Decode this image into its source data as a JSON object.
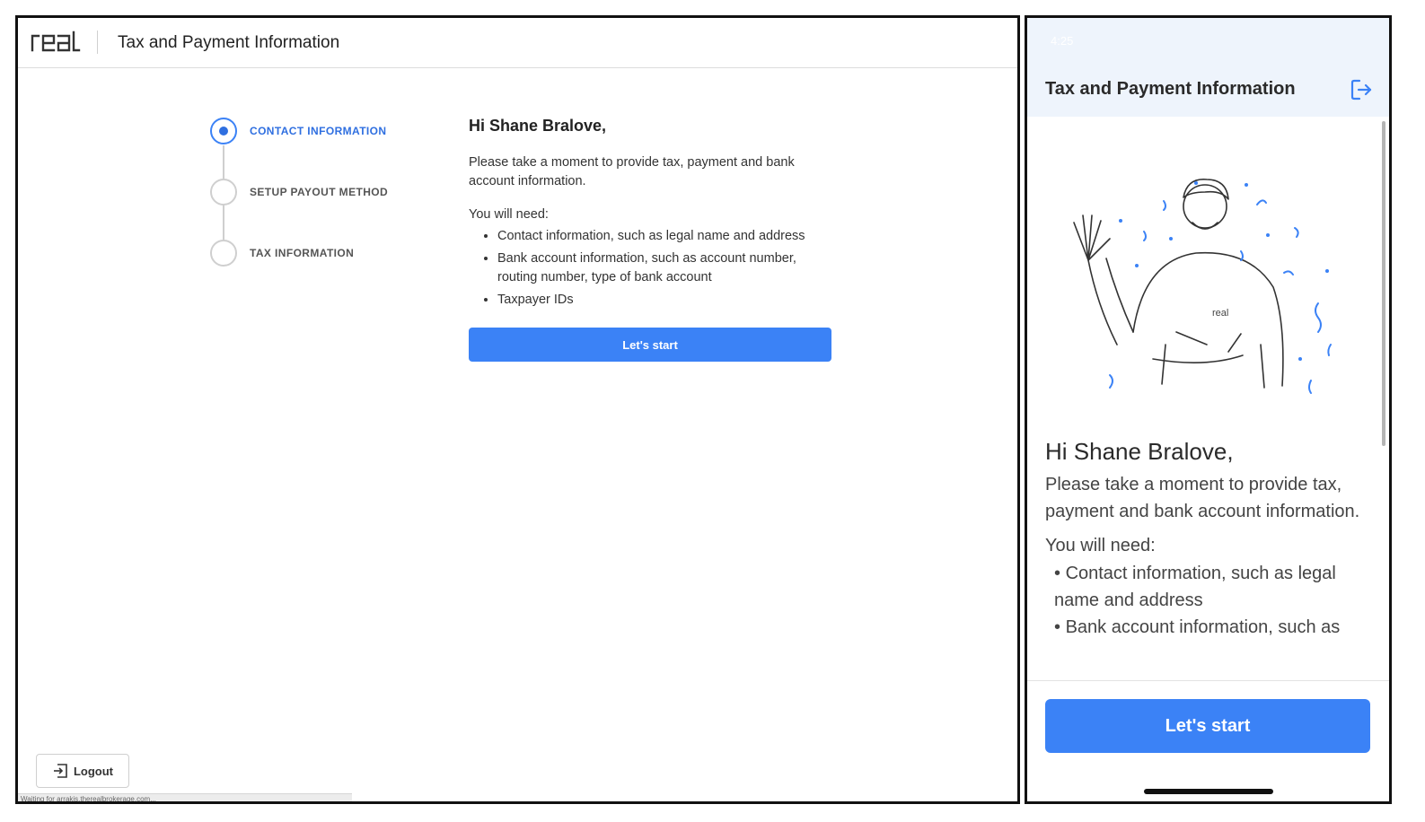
{
  "desktop": {
    "brand": "real",
    "header_title": "Tax and Payment Information",
    "steps": [
      {
        "label": "CONTACT INFORMATION"
      },
      {
        "label": "SETUP PAYOUT METHOD"
      },
      {
        "label": "TAX INFORMATION"
      }
    ],
    "greeting": "Hi Shane Bralove,",
    "intro": "Please take a moment to provide tax, payment and bank account information.",
    "need_heading": "You will need:",
    "needs": [
      "Contact information, such as legal name and address",
      "Bank account information, such as account number, routing number, type of bank account",
      "Taxpayer IDs"
    ],
    "start_label": "Let's start",
    "logout_label": "Logout",
    "status_text": "Waiting for arrakis.therealbrokerage.com..."
  },
  "mobile": {
    "status_time": "4:25",
    "header_title": "Tax and Payment Information",
    "shirt_text": "real",
    "greeting": "Hi Shane Bralove,",
    "intro": "Please take a moment to provide tax, payment and bank account information.",
    "need_heading": "You will need:",
    "needs": [
      "Contact information, such as legal name and address",
      "Bank account information, such as"
    ],
    "start_label": "Let's start"
  },
  "colors": {
    "accent": "#3b82f6",
    "active_step": "#2f6fe0",
    "mobile_header_bg": "#eef4fc"
  }
}
